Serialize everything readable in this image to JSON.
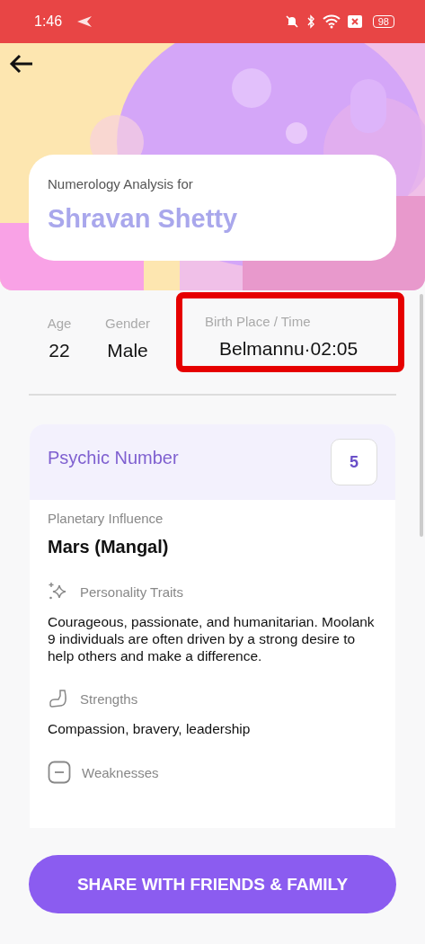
{
  "status_bar": {
    "time": "1:46",
    "battery": "98"
  },
  "header": {
    "subtitle": "Numerology Analysis for",
    "name": "Shravan Shetty"
  },
  "details": [
    {
      "label": "Age",
      "value": "22",
      "highlighted": false
    },
    {
      "label": "Gender",
      "value": "Male",
      "highlighted": false
    },
    {
      "label": "Birth Place / Time",
      "value": "Belmannu·02:05",
      "highlighted": true
    }
  ],
  "number_card": {
    "title": "Psychic Number",
    "number": "5",
    "planet_label": "Planetary Influence",
    "planet": "Mars (Mangal)",
    "sections": [
      {
        "kind": "sparkle",
        "title": "Personality Traits",
        "text": "Courageous, passionate, and humanitarian. Moolank 9 individuals are often driven by a strong desire to help others and make a difference."
      },
      {
        "kind": "arm",
        "title": "Strengths",
        "text": "Compassion, bravery, leadership"
      },
      {
        "kind": "minus",
        "title": "Weaknesses"
      }
    ]
  },
  "share_button": "SHARE WITH FRIENDS & FAMILY"
}
